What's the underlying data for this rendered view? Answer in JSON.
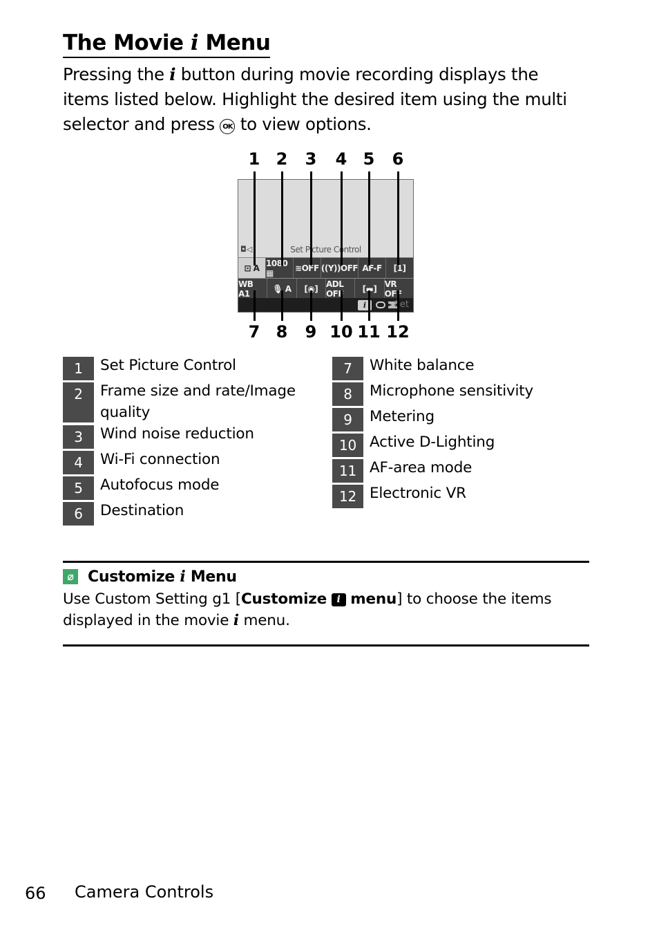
{
  "heading": {
    "title_before": "The Movie",
    "title_glyph": "i",
    "title_after": "Menu"
  },
  "intro": {
    "part1": "Pressing the",
    "glyph": "i",
    "part2": "button during movie recording displays the items listed below. Highlight the desired item using the multi selector and press",
    "ok_icon": "OK",
    "part3": "to view options."
  },
  "camera_screen": {
    "title": "Set Picture Control",
    "mode_icon": "movie-camera-icon",
    "top_callouts": [
      "1",
      "2",
      "3",
      "4",
      "5",
      "6"
    ],
    "bottom_callouts": [
      "7",
      "8",
      "9",
      "10",
      "11",
      "12"
    ],
    "row1": [
      "⊡ A",
      "1080 ▦",
      "≋OFF",
      "((Y))OFF",
      "AF-F",
      "[1]"
    ],
    "row2": [
      "WB A1",
      "🎙 A",
      "[◉]",
      "ADL OFF",
      "[▬]",
      "VR OFF"
    ],
    "bottom_bar": {
      "i_label": "i",
      "set_label": "Set"
    }
  },
  "legend_left": [
    {
      "num": "1",
      "label": "Set Picture Control"
    },
    {
      "num": "2",
      "label": "Frame size and rate/Image quality"
    },
    {
      "num": "3",
      "label": "Wind noise reduction"
    },
    {
      "num": "4",
      "label": "Wi-Fi connection"
    },
    {
      "num": "5",
      "label": "Autofocus mode"
    },
    {
      "num": "6",
      "label": "Destination"
    }
  ],
  "legend_right": [
    {
      "num": "7",
      "label": "White balance"
    },
    {
      "num": "8",
      "label": "Microphone sensitivity"
    },
    {
      "num": "9",
      "label": "Metering"
    },
    {
      "num": "10",
      "label": "Active D-Lighting"
    },
    {
      "num": "11",
      "label": "AF-area mode"
    },
    {
      "num": "12",
      "label": "Electronic VR"
    }
  ],
  "tip": {
    "icon": "paperclip-icon",
    "icon_color": "#3fa76a",
    "title_before": "Customize",
    "title_glyph": "i",
    "title_after": "Menu",
    "body1": "Use Custom Setting g1 [",
    "body_bold1": "Customize",
    "body_icon": "i",
    "body_bold2": "menu",
    "body2": "] to choose the items displayed in the movie",
    "body_glyph": "i",
    "body3": "menu."
  },
  "footer": {
    "page_number": "66",
    "section": "Camera Controls"
  }
}
